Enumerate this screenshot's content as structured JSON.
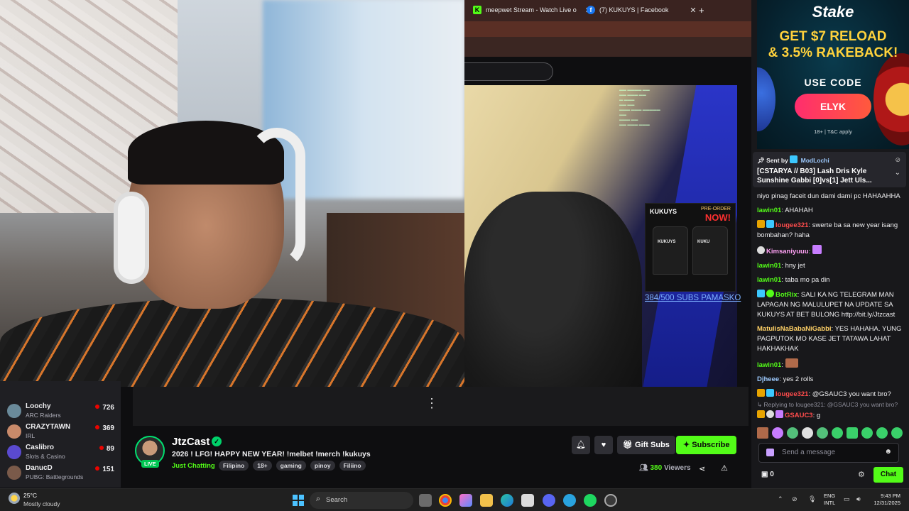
{
  "browser": {
    "tabs": [
      {
        "label": "meepwet Stream - Watch Live o",
        "favicon": "kick-logo-icon"
      },
      {
        "label": "(7) KUKUYS | Facebook",
        "favicon": "facebook-icon"
      }
    ],
    "new_tab": "+",
    "close_glyph": "✕"
  },
  "stream_overlay": {
    "merch_brand": "KUKUYS",
    "merch_pre": "PRE-ORDER",
    "merch_now": "NOW!",
    "tee_text_1": "KUKUYS",
    "tee_text_2": "KUKU",
    "subs_goal": "384/500 SUBS PAMASKO"
  },
  "sidebar": {
    "items": [
      {
        "name": "Loochy",
        "category": "ARC Raiders",
        "viewers": "726",
        "avatar_color": "#6a8a9a"
      },
      {
        "name": "CRAZYTAWN",
        "category": "IRL",
        "viewers": "369",
        "avatar_color": "#c98a6a"
      },
      {
        "name": "Caslibro",
        "category": "Slots & Casino",
        "viewers": "89",
        "avatar_color": "#5a4ad0"
      },
      {
        "name": "DanucD",
        "category": "PUBG: Battlegrounds",
        "viewers": "151",
        "avatar_color": "#7a5a4a"
      }
    ]
  },
  "channel": {
    "name": "JtzCast",
    "live_label": "LIVE",
    "title": "2026 ! LFG! HAPPY NEW YEAR!  !melbet !merch !kukuys",
    "category": "Just Chatting",
    "tags": [
      "Filipino",
      "18+",
      "gaming",
      "pinoy",
      "Filiino"
    ],
    "gift_label": "Gift Subs",
    "subscribe_label": "Subscribe",
    "viewer_count": "380",
    "viewers_label": "Viewers",
    "bell_icon": "bell-icon",
    "heart_icon": "heart-icon"
  },
  "ad": {
    "brand": "Stake",
    "headline_1": "GET $7 RELOAD",
    "headline_2": "& 3.5% RAKEBACK!",
    "use_code": "USE CODE",
    "code": "ELYK",
    "fine_print": "18+ | T&C apply"
  },
  "pinned": {
    "sent_by": "Sent by",
    "sender": "ModLochi",
    "text": "[CSTARYA // B03] Lash Dris Kyle Sunshine Gabbi [0]vs[1] Jett Uls..."
  },
  "chat": {
    "messages": [
      {
        "user": "",
        "color": "#efeff1",
        "text": "niyo pinag faceit dun dami dami pc HAHAAHHA",
        "badges": []
      },
      {
        "user": "lawin01",
        "color": "#53fc18",
        "text": "AHAHAH",
        "badges": []
      },
      {
        "user": "lougee321",
        "color": "#ff4c4c",
        "text": "swerte ba sa new year isang bombahan? haha",
        "badges": [
          "#e7a400",
          "#3cc8ff"
        ]
      },
      {
        "user": "Kimsaniyuuu",
        "color": "#ffa1f5",
        "text": "",
        "badges": [
          "#dddddd"
        ]
      },
      {
        "user": "lawin01",
        "color": "#53fc18",
        "text": "hny jet",
        "badges": []
      },
      {
        "user": "lawin01",
        "color": "#53fc18",
        "text": "taba mo pa din",
        "badges": []
      },
      {
        "user": "BotRix",
        "color": "#53fc18",
        "text": "SALI KA NG TELEGRAM MAN LAPAGAN NG MALULUPET NA UPDATE SA KUKUYS AT BET BULONG http://bit.ly/Jtzcast",
        "badges": [
          "#3cc8ff",
          "#53fc18"
        ]
      },
      {
        "user": "MatulisNaBabaNiGabbi",
        "color": "#ffd166",
        "text": "YES HAHAHA. YUNG PAGPUTOK MO KASE JET TATAWA LAHAT HAKHAKHAK",
        "badges": []
      },
      {
        "user": "lawin01",
        "color": "#53fc18",
        "text": "",
        "badges": []
      },
      {
        "user": "Djheee",
        "color": "#9ecbff",
        "text": "yes 2 rolls",
        "badges": []
      },
      {
        "user": "lougee321",
        "color": "#ff4c4c",
        "text": "@GSAUC3 you want bro?",
        "badges": [
          "#e7a400",
          "#3cc8ff"
        ]
      }
    ],
    "reply_note": "Replying to lougee321: @GSAUC3 you want bro?",
    "last_user": "GSAUC3",
    "last_text": "g",
    "send_placeholder": "Send a message",
    "points": "0",
    "chat_button": "Chat"
  },
  "taskbar": {
    "temp": "25°C",
    "condition": "Mostly cloudy",
    "search": "Search",
    "lang_1": "ENG",
    "lang_2": "INTL",
    "time": "9:43 PM",
    "date": "12/31/2025"
  }
}
